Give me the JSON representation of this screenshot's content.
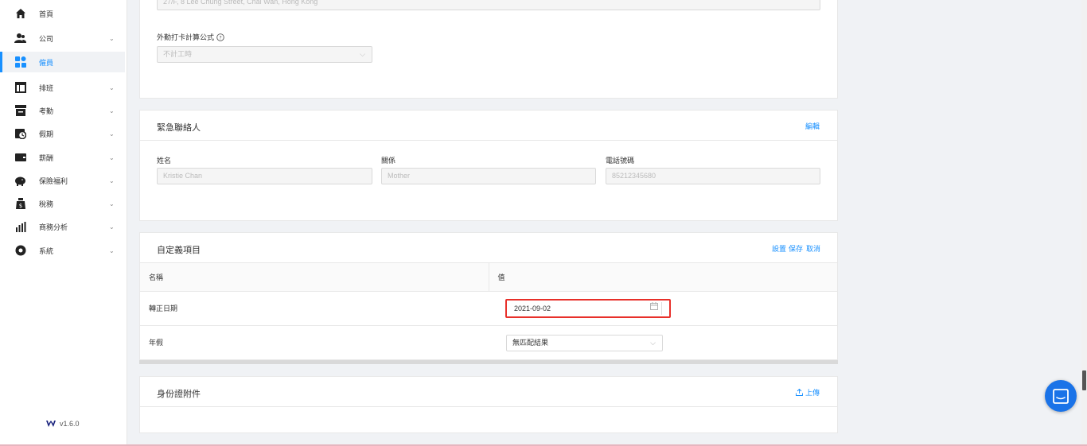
{
  "sidebar": {
    "items": [
      {
        "label": "首頁",
        "icon": "home-icon",
        "has_children": false,
        "active": false
      },
      {
        "label": "公司",
        "icon": "company-icon",
        "has_children": true,
        "active": false
      },
      {
        "label": "僱員",
        "icon": "employee-icon",
        "has_children": false,
        "active": true
      },
      {
        "label": "排班",
        "icon": "schedule-icon",
        "has_children": true,
        "active": false
      },
      {
        "label": "考勤",
        "icon": "attendance-icon",
        "has_children": true,
        "active": false
      },
      {
        "label": "假期",
        "icon": "leave-icon",
        "has_children": true,
        "active": false
      },
      {
        "label": "薪酬",
        "icon": "payroll-icon",
        "has_children": true,
        "active": false
      },
      {
        "label": "保險福利",
        "icon": "insurance-icon",
        "has_children": true,
        "active": false
      },
      {
        "label": "稅務",
        "icon": "tax-icon",
        "has_children": true,
        "active": false
      },
      {
        "label": "商務分析",
        "icon": "analytics-icon",
        "has_children": true,
        "active": false
      },
      {
        "label": "系統",
        "icon": "settings-icon",
        "has_children": true,
        "active": false
      }
    ],
    "version": "v1.6.0"
  },
  "address_card": {
    "address_value": "27/F, 8 Lee Chung Street, Chai Wan, Hong Kong",
    "formula_label": "外勤打卡計算公式",
    "formula_value": "不計工時"
  },
  "emergency": {
    "title": "緊急聯絡人",
    "edit": "編輯",
    "name_label": "姓名",
    "name_value": "Kristie Chan",
    "relation_label": "關係",
    "relation_value": "Mother",
    "phone_label": "電話號碼",
    "phone_value": "85212345680"
  },
  "custom_fields": {
    "title": "自定義項目",
    "actions": {
      "settings": "設置",
      "save": "保存",
      "cancel": "取消"
    },
    "col_name": "名稱",
    "col_value": "值",
    "rows": [
      {
        "name": "轉正日期",
        "value": "2021-09-02"
      },
      {
        "name": "年假",
        "value": "無匹配結果"
      }
    ]
  },
  "id_attachment": {
    "title": "身份證附件",
    "upload": "上傳"
  },
  "colors": {
    "accent": "#1890ff",
    "highlight_border": "#e8302a",
    "chat_button": "#1a73e8"
  }
}
